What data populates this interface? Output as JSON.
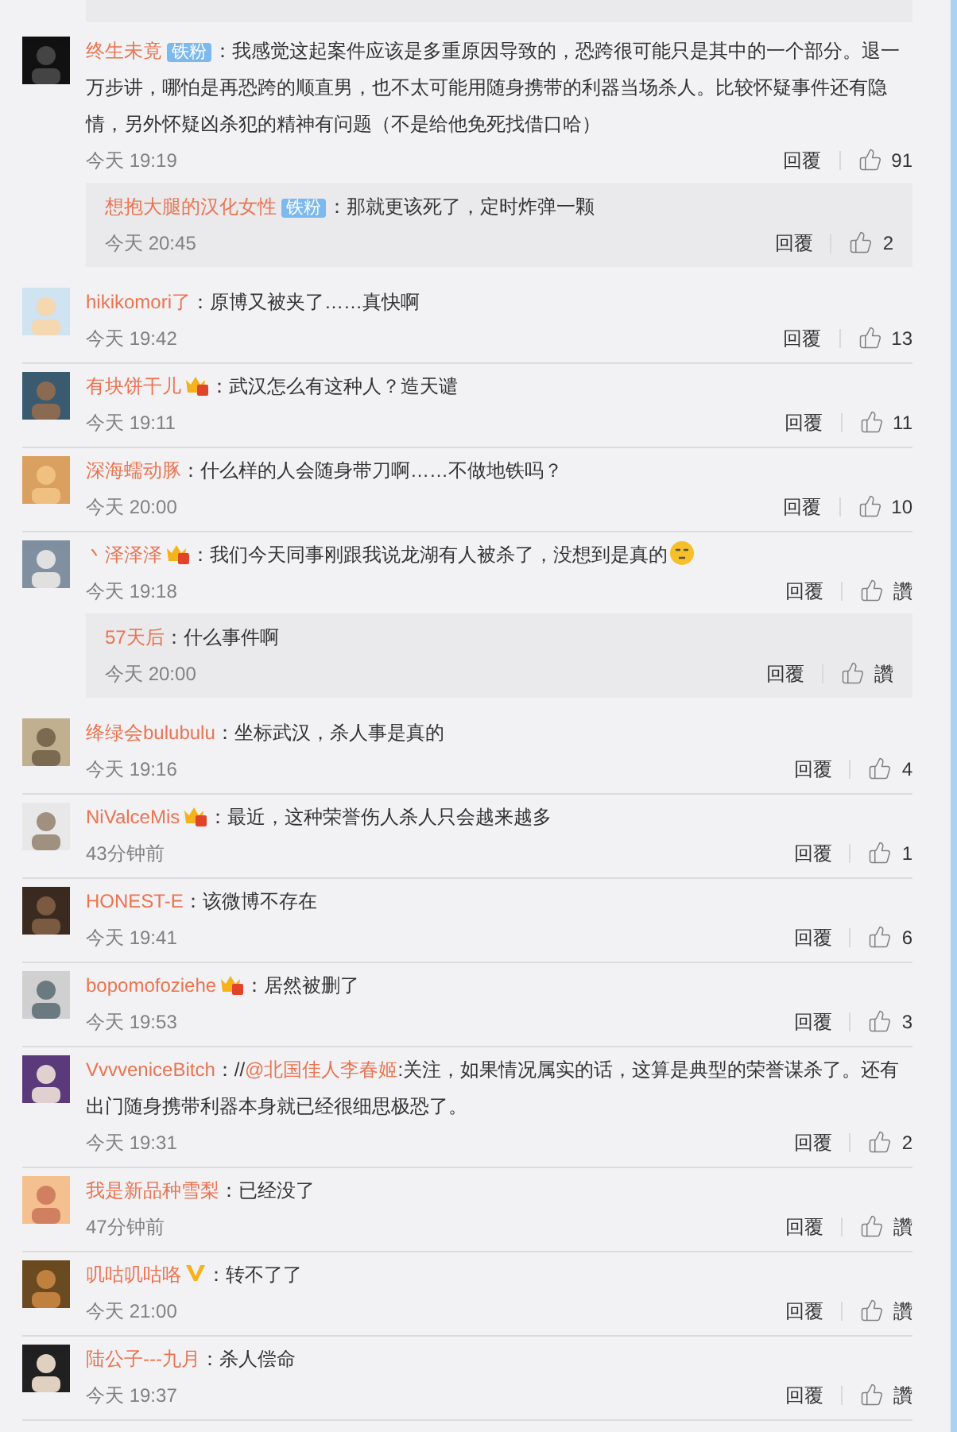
{
  "comments": [
    {
      "user": "终生未竟",
      "badge": {
        "kind": "fan",
        "label": "铁粉"
      },
      "sep": "：",
      "text": "我感觉这起案件应该是多重原因导致的，恐跨很可能只是其中的一个部分。退一万步讲，哪怕是再恐跨的顺直男，也不太可能用随身携带的利器当场杀人。比较怀疑事件还有隐情，另外怀疑凶杀犯的精神有问题（不是给他免死找借口哈）",
      "time": "今天 19:19",
      "reply": "回覆",
      "likes": "91",
      "replies": [
        {
          "user": "想抱大腿的汉化女性",
          "badge": {
            "kind": "fan",
            "label": "铁粉"
          },
          "sep": "：",
          "text": "那就更该死了，定时炸弹一颗",
          "time": "今天 20:45",
          "reply": "回覆",
          "likes": "2"
        }
      ]
    },
    {
      "user": "hikikomori了",
      "sep": "：",
      "text": "原博又被夹了……真快啊",
      "time": "今天 19:42",
      "reply": "回覆",
      "likes": "13"
    },
    {
      "user": "有块饼干儿",
      "badge": {
        "kind": "vip"
      },
      "sep": "：",
      "text": "武汉怎么有这种人？造天谴",
      "time": "今天 19:11",
      "reply": "回覆",
      "likes": "11"
    },
    {
      "user": "深海蠕动豚",
      "sep": "：",
      "text": "什么样的人会随身带刀啊……不做地铁吗？",
      "time": "今天 20:00",
      "reply": "回覆",
      "likes": "10"
    },
    {
      "user": "丶泽泽泽",
      "badge": {
        "kind": "vip"
      },
      "sep": "：",
      "text": "我们今天同事刚跟我说龙湖有人被杀了，没想到是真的",
      "emoji": true,
      "time": "今天 19:18",
      "reply": "回覆",
      "likes": "讚",
      "replies": [
        {
          "user": "57天后",
          "sep": "：",
          "text": "什么事件啊",
          "time": "今天 20:00",
          "reply": "回覆",
          "likes": "讚"
        }
      ]
    },
    {
      "user": "绛绿会bulubulu",
      "sep": "：",
      "text": "坐标武汉，杀人事是真的",
      "time": "今天 19:16",
      "reply": "回覆",
      "likes": "4"
    },
    {
      "user": "NiValceMis",
      "badge": {
        "kind": "vip"
      },
      "sep": "：",
      "text": "最近，这种荣誉伤人杀人只会越来越多",
      "time": "43分钟前",
      "reply": "回覆",
      "likes": "1"
    },
    {
      "user": "HONEST-E",
      "sep": "：",
      "text": "该微博不存在",
      "time": "今天 19:41",
      "reply": "回覆",
      "likes": "6"
    },
    {
      "user": "bopomofoziehe",
      "badge": {
        "kind": "vip"
      },
      "sep": "：",
      "text": "居然被删了",
      "time": "今天 19:53",
      "reply": "回覆",
      "likes": "3"
    },
    {
      "user": "VvvveniceBitch",
      "sep": "：",
      "text_before": "//",
      "mention": "@北国佳人李春姬",
      "text": ":关注，如果情况属实的话，这算是典型的荣誉谋杀了。还有出门随身携带利器本身就已经很细思极恐了。",
      "time": "今天 19:31",
      "reply": "回覆",
      "likes": "2"
    },
    {
      "user": "我是新品种雪梨",
      "sep": "：",
      "text": "已经没了",
      "time": "47分钟前",
      "reply": "回覆",
      "likes": "讚"
    },
    {
      "user": "叽咕叽咕咯",
      "badge": {
        "kind": "verified"
      },
      "sep": "：",
      "text": "转不了了",
      "time": "今天 21:00",
      "reply": "回覆",
      "likes": "讚"
    },
    {
      "user": "陆公子---九月",
      "sep": "：",
      "text": "杀人偿命",
      "time": "今天 19:37",
      "reply": "回覆",
      "likes": "讚"
    }
  ]
}
